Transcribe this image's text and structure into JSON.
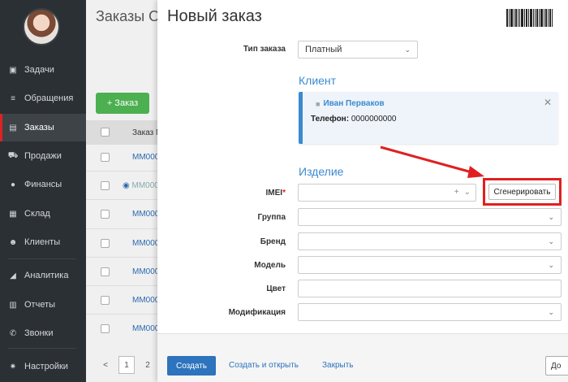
{
  "sidebar": {
    "items": [
      {
        "label": "Задачи",
        "icon": "clipboard-icon"
      },
      {
        "label": "Обращения",
        "icon": "filter-icon"
      },
      {
        "label": "Заказы",
        "icon": "orders-icon"
      },
      {
        "label": "Продажи",
        "icon": "cart-icon"
      },
      {
        "label": "Финансы",
        "icon": "coin-icon"
      },
      {
        "label": "Склад",
        "icon": "warehouse-icon"
      },
      {
        "label": "Клиенты",
        "icon": "users-icon"
      },
      {
        "label": "Аналитика",
        "icon": "chart-icon"
      },
      {
        "label": "Отчеты",
        "icon": "table-icon"
      },
      {
        "label": "Звонки",
        "icon": "phone-icon"
      },
      {
        "label": "Настройки",
        "icon": "gear-icon"
      }
    ]
  },
  "background": {
    "title": "Заказы О",
    "add_button": "+ Заказ",
    "column_header": "Заказ N",
    "rows": [
      "MM000",
      "MM000",
      "MM000",
      "MM000",
      "MM000",
      "MM000",
      "MM000",
      "MM000"
    ],
    "pager": {
      "prev": "<",
      "current": "1",
      "next_page": "2"
    }
  },
  "modal": {
    "title": "Новый заказ",
    "order_type": {
      "label": "Тип заказа",
      "value": "Платный"
    },
    "client_section": "Клиент",
    "client": {
      "name": "Иван Перваков",
      "phone_label": "Телефон:",
      "phone": "0000000000"
    },
    "product_section": "Изделие",
    "imei": {
      "label": "IMEI",
      "required_mark": "*",
      "value": ""
    },
    "generate_button": "Сгенерировать",
    "fields": {
      "group": {
        "label": "Группа",
        "value": ""
      },
      "brand": {
        "label": "Бренд",
        "value": ""
      },
      "model": {
        "label": "Модель",
        "value": ""
      },
      "color": {
        "label": "Цвет",
        "value": ""
      },
      "modification": {
        "label": "Модификация",
        "value": ""
      }
    },
    "footer": {
      "create": "Создать",
      "create_and_open": "Создать и открыть",
      "close": "Закрыть",
      "right_button": "До"
    }
  },
  "colors": {
    "sidebar_bg": "#2b3034",
    "accent_blue": "#3b8ad0",
    "primary_button": "#2d73bd",
    "highlight_red": "#e02020",
    "add_green": "#4caf50"
  }
}
